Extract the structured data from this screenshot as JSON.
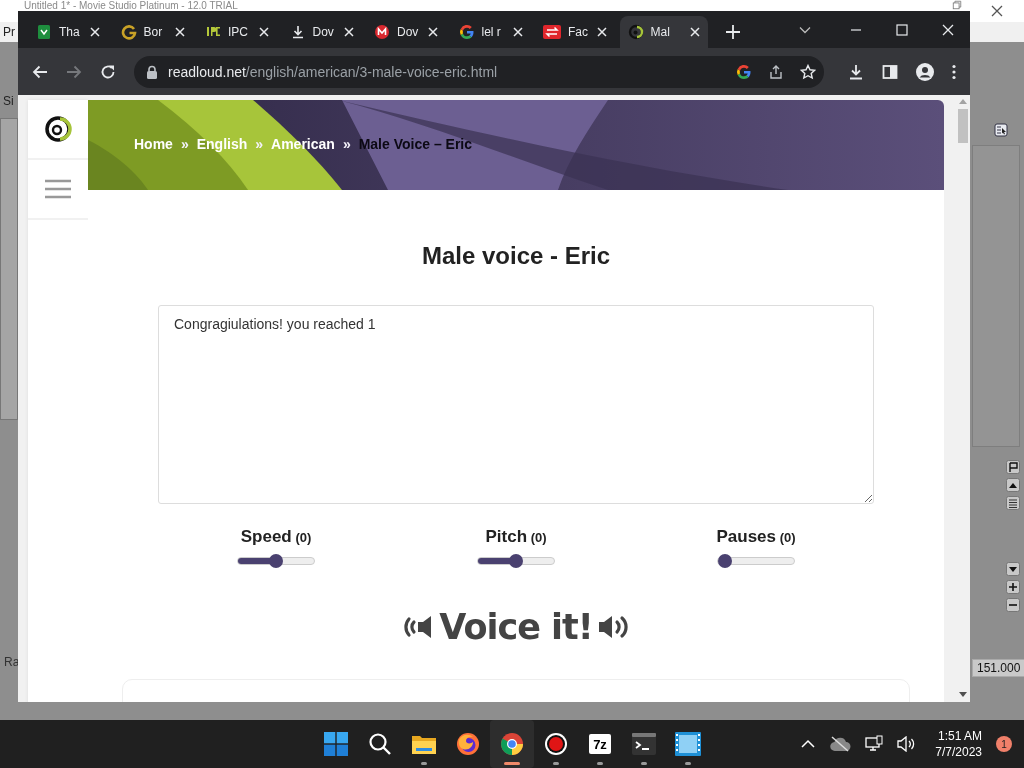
{
  "desktop_app": {
    "title": "Untitled 1* - Movie Studio Platinum - 12.0 TRIAL",
    "labels": [
      {
        "kind": "menu",
        "text": "Pr"
      },
      {
        "kind": "side",
        "text": "Si"
      },
      {
        "kind": "bottom",
        "text": "Ra"
      },
      {
        "kind": "value",
        "text": "151.000"
      }
    ]
  },
  "browser": {
    "tabs": [
      {
        "label": "Tha",
        "kind": "sheets",
        "selected": false
      },
      {
        "label": "Bor",
        "kind": "gletter",
        "selected": false
      },
      {
        "label": "IPC",
        "kind": "ipc",
        "selected": false
      },
      {
        "label": "Dov",
        "kind": "download",
        "selected": false
      },
      {
        "label": "Dov",
        "kind": "mega",
        "selected": false
      },
      {
        "label": "lel r",
        "kind": "google",
        "selected": false
      },
      {
        "label": "Fac",
        "kind": "swap",
        "selected": false
      },
      {
        "label": "Mal",
        "kind": "readloud",
        "selected": true
      }
    ],
    "address": {
      "domain": "readloud.net",
      "path": "/english/american/3-male-voice-eric.html"
    },
    "forward_disabled": true
  },
  "page": {
    "breadcrumb": [
      {
        "label": "Home",
        "current": false,
        "separator": "»"
      },
      {
        "label": "English",
        "current": false,
        "separator": "»"
      },
      {
        "label": "American",
        "current": false,
        "separator": "»"
      },
      {
        "label": "Male Voice – Eric",
        "current": true
      }
    ],
    "title": "Male voice - Eric",
    "text_input": {
      "value": "Congragiulations! you reached 1"
    },
    "sliders": [
      {
        "label": "Speed",
        "reading": "(0)",
        "level": 0.5
      },
      {
        "label": "Pitch",
        "reading": "(0)",
        "level": 0.5
      },
      {
        "label": "Pauses",
        "reading": "(0)",
        "level": 0
      }
    ],
    "voice_button": "Voice it!"
  },
  "taskbar": {
    "apps": [
      {
        "kind": "windows",
        "running": false,
        "active": false
      },
      {
        "kind": "search",
        "running": false,
        "active": false
      },
      {
        "kind": "folder",
        "running": true,
        "active": false
      },
      {
        "kind": "firefox",
        "running": false,
        "active": false
      },
      {
        "kind": "chrome",
        "running": true,
        "active": true
      },
      {
        "kind": "record",
        "running": true,
        "active": false
      },
      {
        "kind": "sevenzip",
        "label": "7z",
        "running": true,
        "active": false
      },
      {
        "kind": "terminal",
        "running": true,
        "active": false
      },
      {
        "kind": "video",
        "running": true,
        "active": false
      }
    ],
    "time": "1:51 AM",
    "date": "7/7/2023",
    "notifications": "1"
  }
}
